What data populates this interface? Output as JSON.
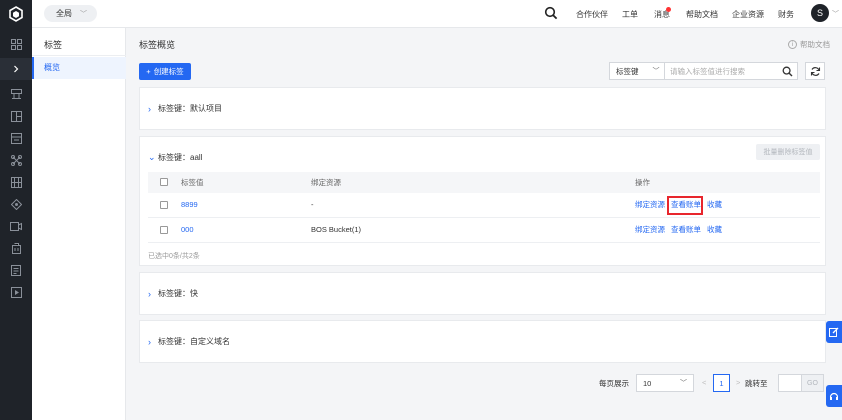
{
  "header": {
    "region": "全局",
    "nav": [
      "合作伙伴",
      "工单",
      "消息",
      "帮助文档",
      "企业资源",
      "财务"
    ],
    "avatar_initial": "S"
  },
  "sidebar": {
    "title": "标签",
    "items": [
      {
        "label": "概览"
      }
    ]
  },
  "main": {
    "title": "标签概览",
    "help": "帮助文档",
    "create_button": "创建标签",
    "search": {
      "select_label": "标签键",
      "placeholder": "请输入标签值进行搜索"
    },
    "panels": [
      {
        "key_label": "标签键：默认项目",
        "expanded": false
      },
      {
        "key_label": "标签键：aall",
        "expanded": true,
        "batch_delete": "批量删除标签值",
        "columns": [
          "标签值",
          "绑定资源",
          "操作"
        ],
        "rows": [
          {
            "value": "8899",
            "resource": "-",
            "ops": [
              "绑定资源",
              "查看账单",
              "收藏"
            ]
          },
          {
            "value": "000",
            "resource": "BOS Bucket(1)",
            "ops": [
              "绑定资源",
              "查看账单",
              "收藏"
            ]
          }
        ],
        "footer": "已选中0条/共2条"
      },
      {
        "key_label": "标签键：快",
        "expanded": false
      },
      {
        "key_label": "标签键：自定义域名",
        "expanded": false
      }
    ],
    "pagination": {
      "per_page_label": "每页展示",
      "per_page": "10",
      "prev": "<",
      "current": "1",
      "next": ">",
      "jump_label": "跳转至",
      "go": "GO"
    }
  },
  "colors": {
    "accent": "#2468f2",
    "rail": "#1f2329",
    "highlight": "#e8262d"
  }
}
